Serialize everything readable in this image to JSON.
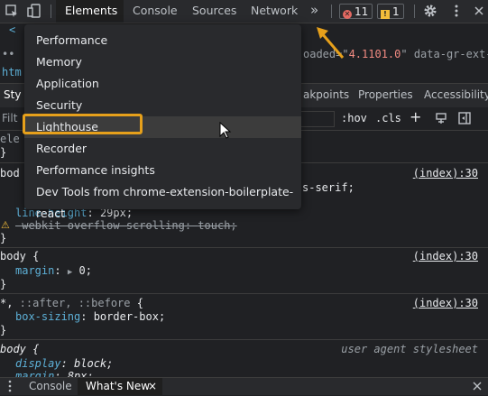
{
  "toolbar": {
    "tabs": [
      "Elements",
      "Console",
      "Sources",
      "Network"
    ],
    "more_tabs": "»",
    "errors_count": "11",
    "warnings_count": "1",
    "icons": [
      "inspect-icon",
      "device-toolbar-icon",
      "gear-icon",
      "kebab-menu-icon"
    ]
  },
  "background": {
    "dom_fragment_a": "oaded=\"",
    "dom_fragment_val": "4.1101.0",
    "dom_fragment_b": "\" data-gr-ext-",
    "dom_html_fragment": "htm",
    "style_tab_fragment": "Sty",
    "filter_fragment": "Filt",
    "element_fragment": "ele",
    "body_fragment": "bod"
  },
  "subtabs": {
    "breakpoints": "akpoints",
    "properties": "Properties",
    "accessibility": "Accessibility"
  },
  "filter": {
    "hov": ":hov",
    "cls": ".cls",
    "add": "+"
  },
  "styles": {
    "rule1_close": "}",
    "rule2_source": "(index):30",
    "rule2_font_frag": "s-serif;",
    "rule2_line_height_prop": "line-height",
    "rule2_line_height_val": "29px;",
    "rule2_webkit_prop": "-webkit-overflow-scrolling",
    "rule2_webkit_val": "touch;",
    "rule3_selector": "body {",
    "rule3_prop": "margin",
    "rule3_val": "0;",
    "rule3_source": "(index):30",
    "rule4_selector_star": "*,",
    "rule4_selector_pseudo": " ::after, ::before",
    "rule4_brace": " {",
    "rule4_prop": "box-sizing",
    "rule4_val": "border-box;",
    "rule4_source": "(index):30",
    "rule5_selector": "body {",
    "rule5_ua": "user agent stylesheet",
    "rule5_prop1": "display",
    "rule5_val1": "block;",
    "rule5_prop2_frag": "margin",
    "rule5_val2_frag": "8px;",
    "close": "}"
  },
  "menu": {
    "items": [
      "Performance",
      "Memory",
      "Application",
      "Security",
      "Lighthouse",
      "Recorder",
      "Performance insights",
      "Dev Tools from chrome-extension-boilerplate-react"
    ],
    "highlighted_item": "Lighthouse"
  },
  "drawer": {
    "tabs": [
      "Console",
      "What's New"
    ],
    "close": "×"
  },
  "colors": {
    "highlight_box": "#e6a01b",
    "annotation_arrow": "#e6a01b",
    "error": "#e46962",
    "warning": "#f2bc3a",
    "css_property": "#5db0d7"
  }
}
